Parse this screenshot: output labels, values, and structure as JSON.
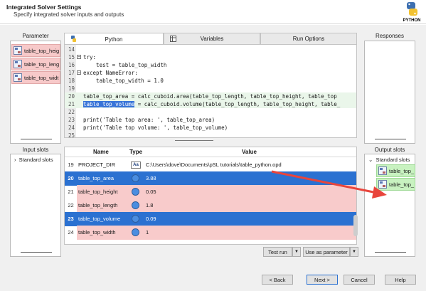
{
  "header": {
    "title": "Integrated Solver Settings",
    "subtitle": "Specify integrated solver inputs and outputs",
    "logo_text": "PYTHON"
  },
  "left": {
    "parameter_title": "Parameter",
    "parameters": [
      "table_top_heig",
      "table_top_leng",
      "table_top_widt"
    ],
    "input_slots_title": "Input slots",
    "input_tree": "Standard slots"
  },
  "right": {
    "responses_title": "Responses",
    "output_slots_title": "Output slots",
    "output_tree": "Standard slots",
    "outputs": [
      "table_top_",
      "table_top_"
    ]
  },
  "tabs": [
    "Python",
    "Variables",
    "Run Options"
  ],
  "code": [
    {
      "n": "14",
      "text": ""
    },
    {
      "n": "15",
      "text": "try:"
    },
    {
      "n": "16",
      "text": "    test = table_top_width"
    },
    {
      "n": "17",
      "text": "except NameError:"
    },
    {
      "n": "18",
      "text": "    table_top_width = 1.0"
    },
    {
      "n": "19",
      "text": ""
    },
    {
      "n": "20",
      "text": "table_top_area = calc_cuboid.area(table_top_length, table_top_height, table_top"
    },
    {
      "n": "21",
      "text_sel": "table_top_volume",
      "text_rest": " = calc_cuboid.volume(table_top_length, table_top_height, table_"
    },
    {
      "n": "22",
      "text": ""
    },
    {
      "n": "23",
      "text": "print('Table top area: ', table_top_area)"
    },
    {
      "n": "24",
      "text": "print('Table top volume: ', table_top_volume)"
    },
    {
      "n": "25",
      "text": ""
    }
  ],
  "table": {
    "headers": {
      "name": "Name",
      "type": "Type",
      "value": "Value"
    },
    "rows": [
      {
        "num": "19",
        "name": "PROJECT_DIR",
        "type": "Aa",
        "value": "C:\\Users\\dove\\Documents\\pSL tutorials\\table_python.opd",
        "style": "plain"
      },
      {
        "num": "20",
        "name": "table_top_area",
        "type": "dot",
        "value": "3.88",
        "style": "sel"
      },
      {
        "num": "21",
        "name": "table_top_height",
        "type": "dot",
        "value": "0.05",
        "style": "pink"
      },
      {
        "num": "22",
        "name": "table_top_length",
        "type": "dot",
        "value": "1.8",
        "style": "pink"
      },
      {
        "num": "23",
        "name": "table_top_volume",
        "type": "dot",
        "value": "0.09",
        "style": "sel"
      },
      {
        "num": "24",
        "name": "table_top_width",
        "type": "dot",
        "value": "1",
        "style": "pink"
      }
    ]
  },
  "actions": {
    "test_run": "Test run",
    "use_as_parameter": "Use as parameter"
  },
  "footer": {
    "back": "< Back",
    "next": "Next >",
    "cancel": "Cancel",
    "help": "Help"
  },
  "colors": {
    "accent": "#2b71d1",
    "pink": "#f8cbcb",
    "green": "#c8f2c0",
    "arrow": "#e8453c"
  }
}
